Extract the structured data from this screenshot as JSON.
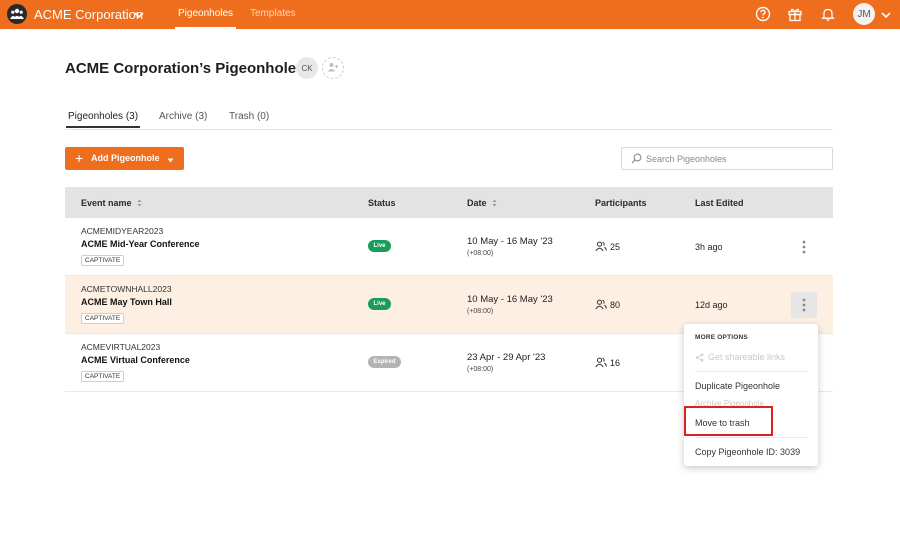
{
  "topbar": {
    "org_name": "ACME Corporation",
    "nav": [
      {
        "label": "Pigeonholes",
        "active": true
      },
      {
        "label": "Templates",
        "active": false
      }
    ],
    "icons": [
      "help-icon",
      "gift-icon",
      "bell-icon"
    ],
    "user_initials": "JM"
  },
  "header": {
    "title": "ACME Corporation’s Pigeonholes",
    "collaborator_initials": "CK"
  },
  "tabs": [
    {
      "label": "Pigeonholes (3)",
      "active": true
    },
    {
      "label": "Archive (3)",
      "active": false
    },
    {
      "label": "Trash (0)",
      "active": false
    }
  ],
  "toolbar": {
    "add_label": "Add Pigeonhole",
    "search_placeholder": "Search Pigeonholes"
  },
  "table": {
    "columns": [
      "Event name",
      "Status",
      "Date",
      "Participants",
      "Last Edited"
    ],
    "rows": [
      {
        "code": "ACMEMIDYEAR2023",
        "name": "ACME Mid-Year Conference",
        "tag": "CAPTIVATE",
        "status": "Live",
        "date": "10 May - 16 May '23",
        "tz": "(+08:00)",
        "participants": "25",
        "edited": "3h ago"
      },
      {
        "code": "ACMETOWNHALL2023",
        "name": "ACME May Town Hall",
        "tag": "CAPTIVATE",
        "status": "Live",
        "date": "10 May - 16 May '23",
        "tz": "(+08:00)",
        "participants": "80",
        "edited": "12d ago"
      },
      {
        "code": "ACMEVIRTUAL2023",
        "name": "ACME Virtual Conference",
        "tag": "CAPTIVATE",
        "status": "Expired",
        "date": "23 Apr - 29 Apr '23",
        "tz": "(+08:00)",
        "participants": "16",
        "edited": ""
      }
    ]
  },
  "menu": {
    "heading": "MORE OPTIONS",
    "share_label": "Get shareable links",
    "duplicate_label": "Duplicate Pigeonhole",
    "archive_label": "Archive Pigeonhole",
    "trash_label": "Move to trash",
    "copy_id_label": "Copy Pigeonhole ID: 3039"
  },
  "colors": {
    "brand": "#ee6e1e",
    "live": "#1a9d5a",
    "expired": "#b3b3b3",
    "highlight_row": "#fdf0e3",
    "annotation": "#e02020"
  }
}
